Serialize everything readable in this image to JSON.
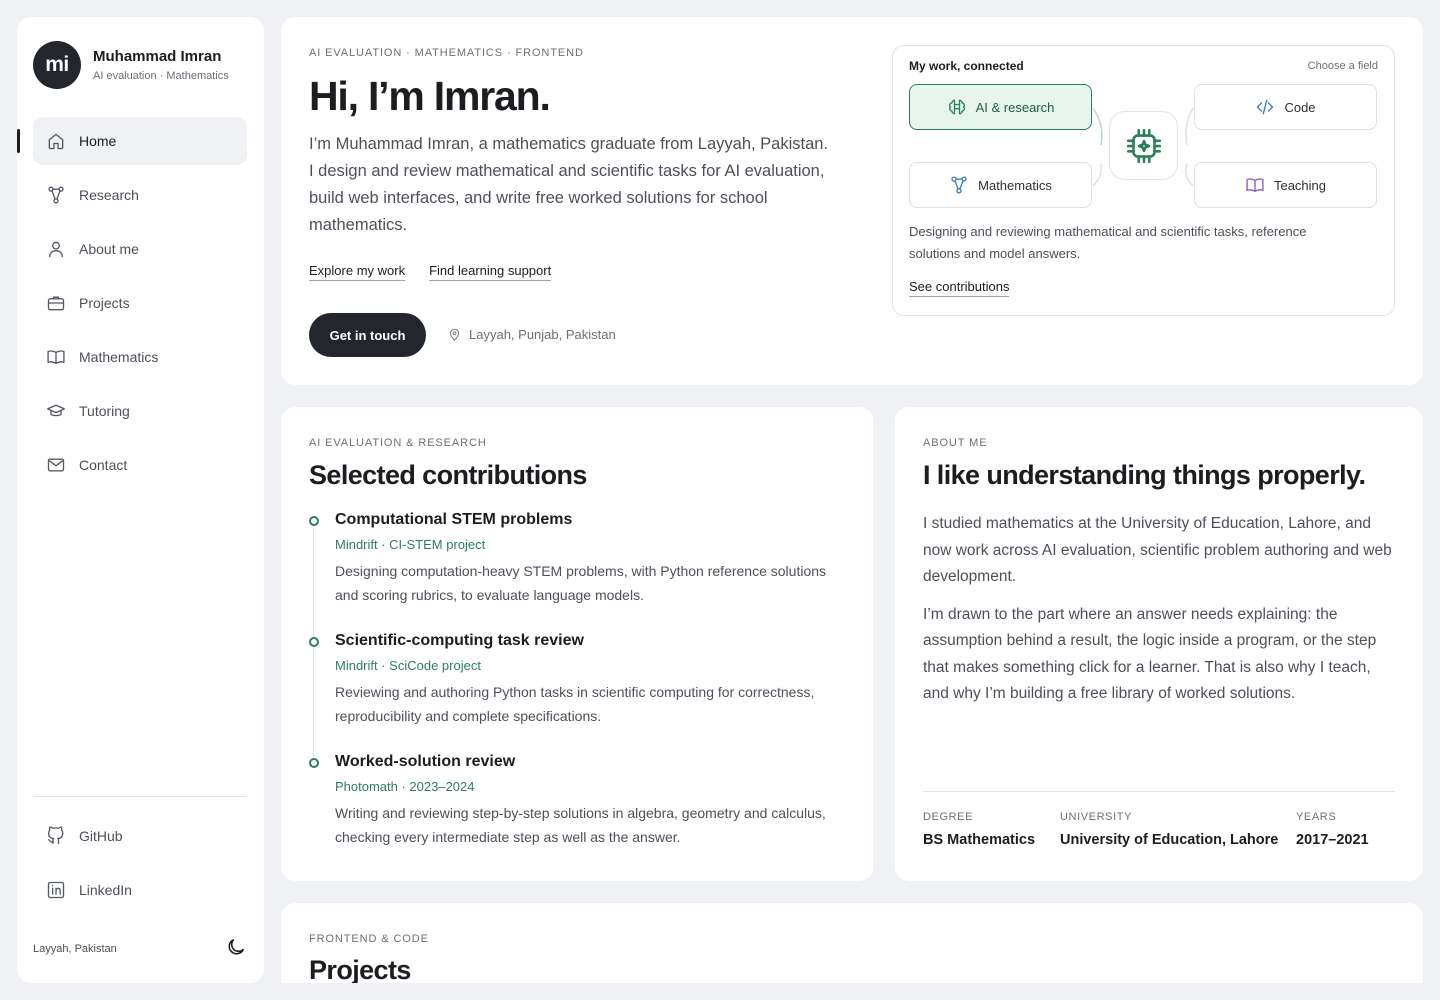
{
  "profile": {
    "initials": "mi",
    "name": "Muhammad Imran",
    "tagline": "AI evaluation · Mathematics"
  },
  "nav": [
    {
      "label": "Home",
      "icon": "home-icon",
      "active": true
    },
    {
      "label": "Research",
      "icon": "network-icon"
    },
    {
      "label": "About me",
      "icon": "user-icon"
    },
    {
      "label": "Projects",
      "icon": "briefcase-icon"
    },
    {
      "label": "Mathematics",
      "icon": "book-icon"
    },
    {
      "label": "Tutoring",
      "icon": "graduation-cap-icon"
    },
    {
      "label": "Contact",
      "icon": "mail-icon"
    }
  ],
  "social": [
    {
      "label": "GitHub",
      "icon": "github-icon"
    },
    {
      "label": "LinkedIn",
      "icon": "linkedin-icon"
    }
  ],
  "sidebar_footer": {
    "location": "Layyah, Pakistan",
    "theme_icon": "moon-icon"
  },
  "hero": {
    "eyebrow": "AI EVALUATION · MATHEMATICS · FRONTEND",
    "title": "Hi, I’m Imran.",
    "description": "I’m Muhammad Imran, a mathematics graduate from Layyah, Pakistan. I design and review mathematical and scientific tasks for AI evaluation, build web interfaces, and write free worked solutions for school mathematics.",
    "link_work": "Explore my work",
    "link_support": "Find learning support",
    "cta": "Get in touch",
    "location": "Layyah, Punjab, Pakistan"
  },
  "connected": {
    "title": "My work, connected",
    "choose": "Choose a field",
    "fields": {
      "ai": "AI & research",
      "code": "Code",
      "math": "Mathematics",
      "teaching": "Teaching"
    },
    "active_field": "ai",
    "description": "Designing and reviewing mathematical and scientific tasks, reference solutions and model answers.",
    "link": "See contributions",
    "accent": "#2e7d5b"
  },
  "contributions": {
    "eyebrow": "AI EVALUATION & RESEARCH",
    "title": "Selected contributions",
    "items": [
      {
        "title": "Computational STEM problems",
        "meta": "Mindrift · CI-STEM project",
        "desc": "Designing computation-heavy STEM problems, with Python reference solutions and scoring rubrics, to evaluate language models."
      },
      {
        "title": "Scientific-computing task review",
        "meta": "Mindrift · SciCode project",
        "desc": "Reviewing and authoring Python tasks in scientific computing for correctness, reproducibility and complete specifications."
      },
      {
        "title": "Worked-solution review",
        "meta": "Photomath · 2023–2024",
        "desc": "Writing and reviewing step-by-step solutions in algebra, geometry and calculus, checking every intermediate step as well as the answer."
      }
    ]
  },
  "about": {
    "eyebrow": "ABOUT ME",
    "title": "I like understanding things properly.",
    "p1": "I studied mathematics at the University of Education, Lahore, and now work across AI evaluation, scientific problem authoring and web development.",
    "p2": "I’m drawn to the part where an answer needs explaining: the assumption behind a result, the logic inside a program, or the step that makes something click for a learner. That is also why I teach, and why I’m building a free library of worked solutions.",
    "facts": [
      {
        "label": "DEGREE",
        "value": "BS Mathematics"
      },
      {
        "label": "UNIVERSITY",
        "value": "University of Education, Lahore"
      },
      {
        "label": "YEARS",
        "value": "2017–2021"
      }
    ]
  },
  "projects": {
    "eyebrow": "FRONTEND & CODE",
    "title": "Projects"
  }
}
